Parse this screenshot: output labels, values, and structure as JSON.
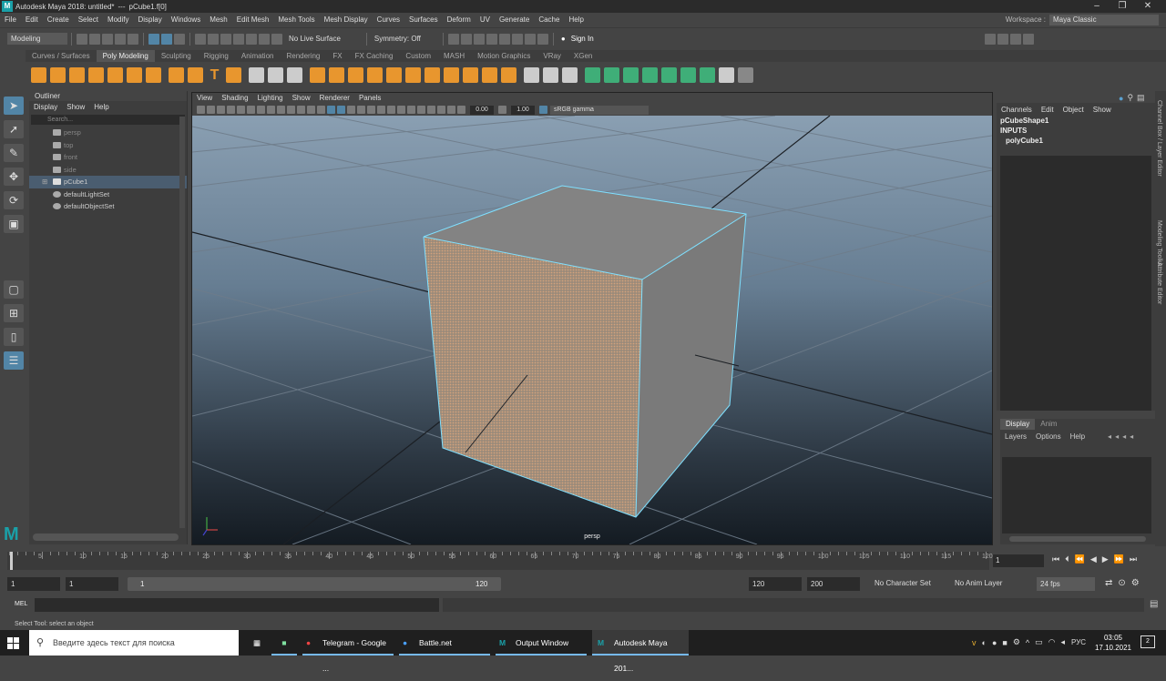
{
  "titlebar": {
    "app": "Autodesk Maya 2018: untitled*",
    "separator": "---",
    "object": "pCube1.f[0]"
  },
  "menu": [
    "File",
    "Edit",
    "Create",
    "Select",
    "Modify",
    "Display",
    "Windows",
    "Mesh",
    "Edit Mesh",
    "Mesh Tools",
    "Mesh Display",
    "Curves",
    "Surfaces",
    "Deform",
    "UV",
    "Generate",
    "Cache",
    "Help"
  ],
  "workspace": {
    "label": "Workspace :",
    "value": "Maya Classic"
  },
  "status": {
    "mode": "Modeling",
    "live": "No Live Surface",
    "symmetry": "Symmetry: Off",
    "signin": "Sign In"
  },
  "shelf_tabs": [
    "Curves / Surfaces",
    "Poly Modeling",
    "Sculpting",
    "Rigging",
    "Animation",
    "Rendering",
    "FX",
    "FX Caching",
    "Custom",
    "MASH",
    "Motion Graphics",
    "VRay",
    "XGen"
  ],
  "shelf_active": "Poly Modeling",
  "outliner": {
    "title": "Outliner",
    "menu": [
      "Display",
      "Show",
      "Help"
    ],
    "search_placeholder": "Search...",
    "items": [
      "persp",
      "top",
      "front",
      "side",
      "pCube1",
      "defaultLightSet",
      "defaultObjectSet"
    ]
  },
  "viewport": {
    "menu": [
      "View",
      "Shading",
      "Lighting",
      "Show",
      "Renderer",
      "Panels"
    ],
    "exposure": "0.00",
    "gamma": "1.00",
    "colorspace": "sRGB gamma",
    "camera_label": "persp"
  },
  "channelbox": {
    "menu": [
      "Channels",
      "Edit",
      "Object",
      "Show"
    ],
    "shape": "pCubeShape1",
    "inputs": "INPUTS",
    "input_node": "polyCube1"
  },
  "layers": {
    "tabs": [
      "Display",
      "Anim"
    ],
    "menu": [
      "Layers",
      "Options",
      "Help"
    ]
  },
  "side_tabs": [
    "Channel Box / Layer Editor",
    "Modeling Toolkit",
    "Attribute Editor"
  ],
  "timeline": {
    "ticks": [
      "5",
      "10",
      "15",
      "20",
      "25",
      "30",
      "35",
      "40",
      "45",
      "50",
      "55",
      "60",
      "65",
      "70",
      "75",
      "80",
      "85",
      "90",
      "95",
      "100",
      "105",
      "110",
      "115",
      "120"
    ],
    "current": "1"
  },
  "range": {
    "start": "1",
    "playback_start": "1",
    "slider_start": "1",
    "slider_end": "120",
    "playback_end": "120",
    "end": "200",
    "character_set": "No Character Set",
    "anim_layer": "No Anim Layer",
    "fps": "24 fps"
  },
  "mel": {
    "label": "MEL"
  },
  "helpline": "Select Tool: select an object",
  "taskbar": {
    "search": "Введите здесь текст для поиска",
    "apps": [
      "Telegram - Google ...",
      "Battle.net",
      "Output Window",
      "Autodesk Maya 201..."
    ],
    "lang": "РУС",
    "time": "03:05",
    "date": "17.10.2021",
    "notify_count": "2"
  },
  "colors": {
    "selection": "#5285a6",
    "face_highlight": "#d4a27c",
    "edge_highlight": "#7fe0ff"
  }
}
